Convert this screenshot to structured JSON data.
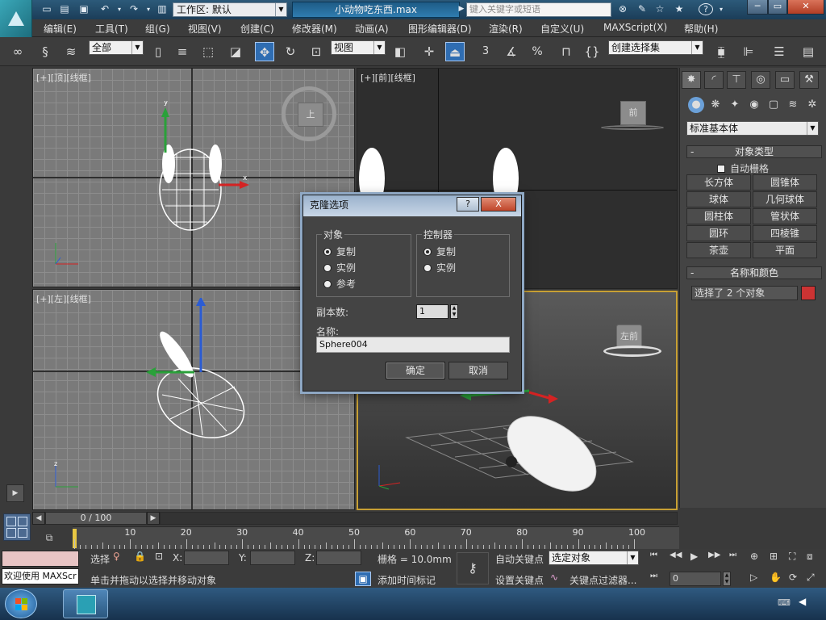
{
  "titlebar": {
    "workspace_label": "工作区: 默认",
    "filename": "小动物吃东西.max",
    "search_placeholder": "键入关键字或短语",
    "help_label": "?"
  },
  "menu": [
    "编辑(E)",
    "工具(T)",
    "组(G)",
    "视图(V)",
    "创建(C)",
    "修改器(M)",
    "动画(A)",
    "图形编辑器(D)",
    "渲染(R)",
    "自定义(U)",
    "MAXScript(X)",
    "帮助(H)"
  ],
  "toolbar": {
    "filter_value": "全部",
    "refcoord_value": "视图",
    "selset_value": "创建选择集",
    "snap_3": "3",
    "percent": "%"
  },
  "viewports": {
    "top": {
      "label": "[+][顶][线框]",
      "cube": "上"
    },
    "front": {
      "label": "[+][前][线框]",
      "cube": "前"
    },
    "left": {
      "label": "[+][左][线框]"
    },
    "persp": {
      "cube": "左前"
    },
    "axis_x": "x",
    "axis_y": "y",
    "axis_z": "z"
  },
  "dialog": {
    "title": "克隆选项",
    "object_group": "对象",
    "object_options": [
      "复制",
      "实例",
      "参考"
    ],
    "controller_group": "控制器",
    "controller_options": [
      "复制",
      "实例"
    ],
    "copies_label": "副本数:",
    "copies_value": "1",
    "name_label": "名称:",
    "name_value": "Sphere004",
    "ok": "确定",
    "cancel": "取消",
    "help_btn": "?",
    "close_btn": "X"
  },
  "cmdpanel": {
    "dropdown": "标准基本体",
    "object_type_title": "对象类型",
    "autogrid": "自动栅格",
    "primitives": [
      "长方体",
      "圆锥体",
      "球体",
      "几何球体",
      "圆柱体",
      "管状体",
      "圆环",
      "四棱锥",
      "茶壶",
      "平面"
    ],
    "name_color_title": "名称和颜色",
    "selection_text": "选择了 2 个对象",
    "color": "#cc3333",
    "rollup_minus": "-"
  },
  "timeline": {
    "frame_display": "0 / 100",
    "ticks": [
      "10",
      "20",
      "30",
      "40",
      "50",
      "60",
      "70",
      "80",
      "90",
      "100"
    ],
    "frame_zero": "0"
  },
  "status": {
    "welcome": "欢迎使用 MAXScr",
    "sel_label": "选择",
    "x_label": "X:",
    "y_label": "Y:",
    "z_label": "Z:",
    "grid": "栅格 = 10.0mm",
    "prompt": "单击并拖动以选择并移动对象",
    "auto_key": "自动关键点",
    "set_key": "设置关键点",
    "selected_objects": "选定对象",
    "add_time_tag": "添加时间标记",
    "key_filters": "关键点过滤器...",
    "frame_value": "0"
  }
}
